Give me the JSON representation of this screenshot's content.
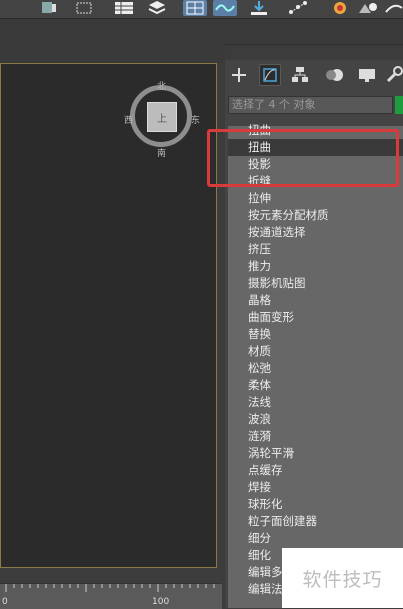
{
  "compass": {
    "north": "北",
    "south": "南",
    "east": "东",
    "west": "西",
    "cube_face": "上"
  },
  "panel": {
    "selection_text": "选择了 4 个 对象",
    "selection_color": "#1e9c3f"
  },
  "modifier_list": {
    "items": [
      "扭曲",
      "扭曲",
      "投影",
      "折缝",
      "拉伸",
      "按元素分配材质",
      "按通道选择",
      "挤压",
      "推力",
      "摄影机贴图",
      "晶格",
      "曲面变形",
      "替换",
      "材质",
      "松弛",
      "柔体",
      "法线",
      "波浪",
      "涟漪",
      "涡轮平滑",
      "点缓存",
      "焊接",
      "球形化",
      "粒子面创建器",
      "细分",
      "细化",
      "编辑多",
      "编辑法"
    ],
    "highlighted_index": 1
  },
  "timeline": {
    "tick_0": "0",
    "tick_100": "100"
  },
  "watermark": "软件技巧"
}
